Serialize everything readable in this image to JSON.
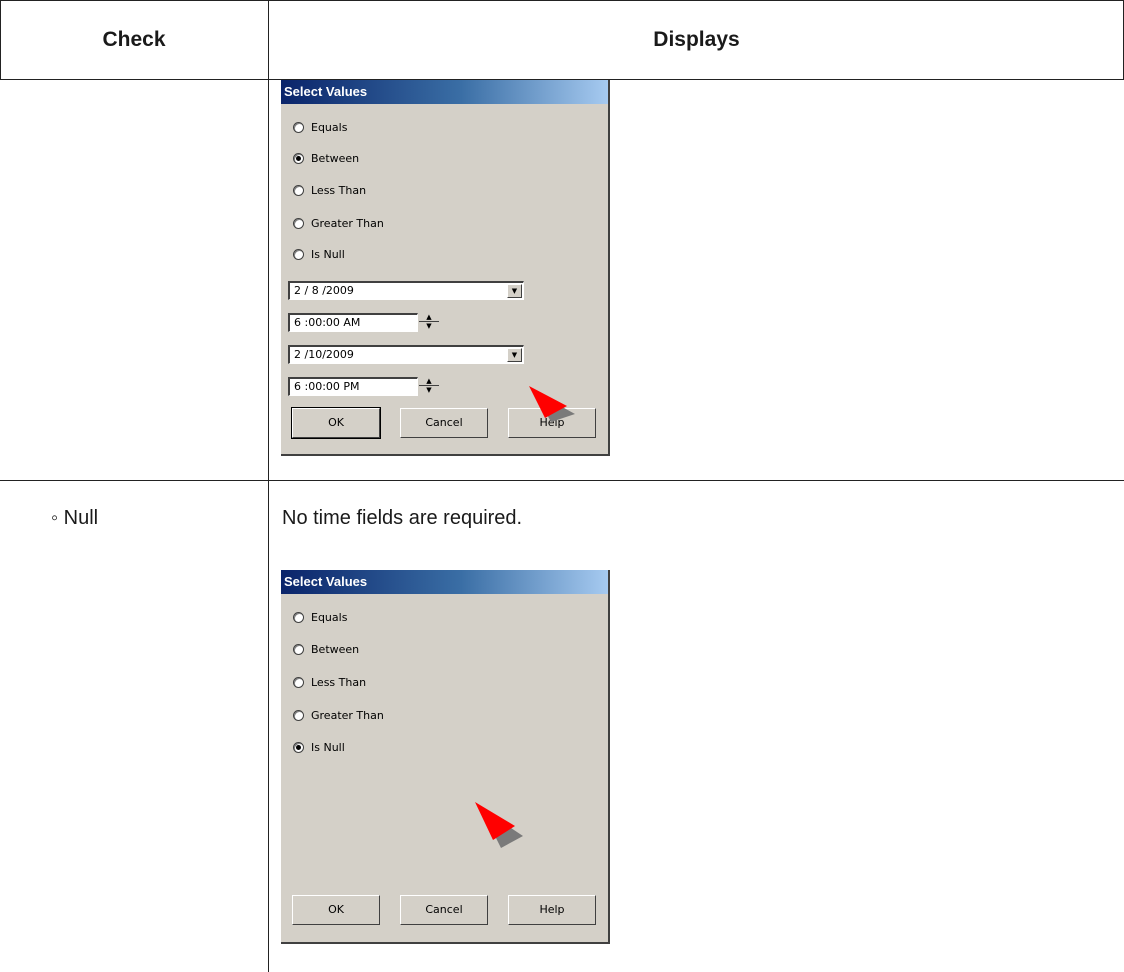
{
  "header": {
    "check": "Check",
    "displays": "Displays"
  },
  "rows": [
    {
      "check": "",
      "note": "",
      "dialog": {
        "title": "Select Values",
        "options": [
          "Equals",
          "Between",
          "Less Than",
          "Greater Than",
          "Is Null"
        ],
        "selected": "Between",
        "start_date": "2 / 8 /2009",
        "start_time": "6 :00:00 AM",
        "end_date": "2 /10/2009",
        "end_time": "6 :00:00 PM",
        "buttons": {
          "ok": "OK",
          "cancel": "Cancel",
          "help": "Help"
        }
      }
    },
    {
      "check": "◦ Null",
      "note": "No time fields are required.",
      "dialog": {
        "title": "Select Values",
        "options": [
          "Equals",
          "Between",
          "Less Than",
          "Greater Than",
          "Is Null"
        ],
        "selected": "Is Null",
        "buttons": {
          "ok": "OK",
          "cancel": "Cancel",
          "help": "Help"
        }
      }
    }
  ],
  "colors": {
    "titlebar_start": "#0a246a",
    "dialog_bg": "#d4d0c8",
    "pointer": "#ff0000"
  }
}
